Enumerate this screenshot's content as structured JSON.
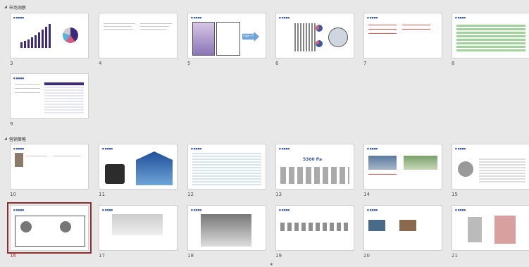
{
  "sections": [
    {
      "label": "市场洞察"
    },
    {
      "label": "营销策略"
    }
  ],
  "slides": [
    {
      "number": "3"
    },
    {
      "number": "4"
    },
    {
      "number": "5"
    },
    {
      "number": "6"
    },
    {
      "number": "7"
    },
    {
      "number": "8"
    },
    {
      "number": "9"
    },
    {
      "number": "10"
    },
    {
      "number": "11"
    },
    {
      "number": "12"
    },
    {
      "number": "13"
    },
    {
      "number": "14"
    },
    {
      "number": "15"
    },
    {
      "number": "16"
    },
    {
      "number": "17"
    },
    {
      "number": "18"
    },
    {
      "number": "19"
    },
    {
      "number": "20"
    },
    {
      "number": "21"
    }
  ],
  "selected_slide": "16",
  "slide5_callout": "产品新一代",
  "slide13_big_text": "5300 Pa",
  "slide18_marker": "★",
  "colors": {
    "selected_border": "#8b2e2e",
    "selected_number": "#c0392b",
    "accent": "#3a5ba0"
  }
}
